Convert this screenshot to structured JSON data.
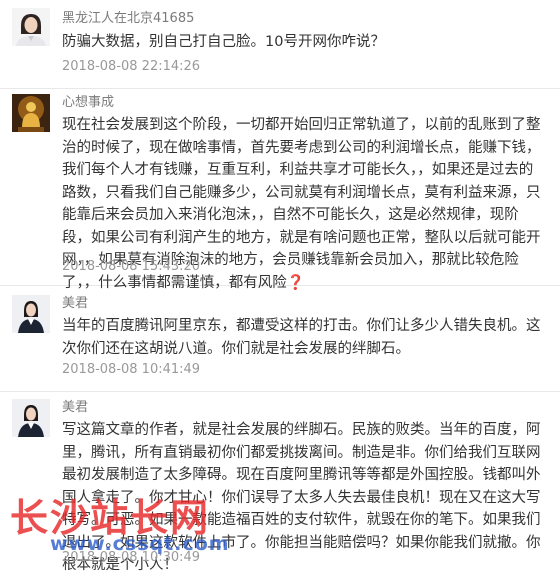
{
  "comments": [
    {
      "username": "黑龙江人在北京41685",
      "text": "防骗大数据，别自己打自己脸。10号开网你咋说？",
      "time": "2018-08-08 22:14:26",
      "avatar": "woman-portrait-avatar"
    },
    {
      "username": "心想事成",
      "text": "现在社会发展到这个阶段，一切都开始回归正常轨道了，以前的乱账到了整治的时候了，现在做啥事情，首先要考虑到公司的利润增长点，能赚下钱，我们每个人才有钱赚，互重互利，利益共享才可能长久，，如果还是过去的路数，只看我们自己能赚多少，公司就莫有利润增长点，莫有利益来源，只能靠后来会员加入来消化泡沫，，自然不可能长久，这是必然规律，现阶段，如果公司有利润产生的地方，就是有啥问题也正常，整队以后就可能开网，，如果莫有消除泡沫的地方，会员赚钱靠新会员加入，那就比较危险了，，什么事情都需谨慎，都有风险",
      "question_mark": "❓",
      "time": "2018-08-08 15:43:20",
      "avatar": "buddha-image-avatar"
    },
    {
      "username": "美君",
      "text": "当年的百度腾讯阿里京东，都遭受这样的打击。你们让多少人错失良机。这次你们还在这胡说八道。你们就是社会发展的绊脚石。",
      "time": "2018-08-08 10:41:49",
      "avatar": "woman-portrait-avatar"
    },
    {
      "username": "美君",
      "text": "写这篇文章的作者，就是社会发展的绊脚石。民族的败类。当年的百度，阿里，腾讯，所有直销最初你们都爱挑拨离间。制造是非。你们给我们互联网最初发展制造了太多障碍。现在百度阿里腾讯等等都是外国控股。钱都叫外国人拿走了。你才甘心！你们误导了太多人失去最佳良机！现在又在这大写特写。可恶。如果一款能造福百姓的支付软件，就毁在你的笔下。如果我们退出了。如果这款软件上市了。你能担当能赔偿吗？如果你能我们就撤。你根本就是个小人！",
      "time": "2018-08-08 10:30:49",
      "avatar": "woman-portrait-avatar"
    }
  ],
  "watermark": {
    "text_cn": "长沙站长网",
    "url": "www.cssqt.com"
  }
}
